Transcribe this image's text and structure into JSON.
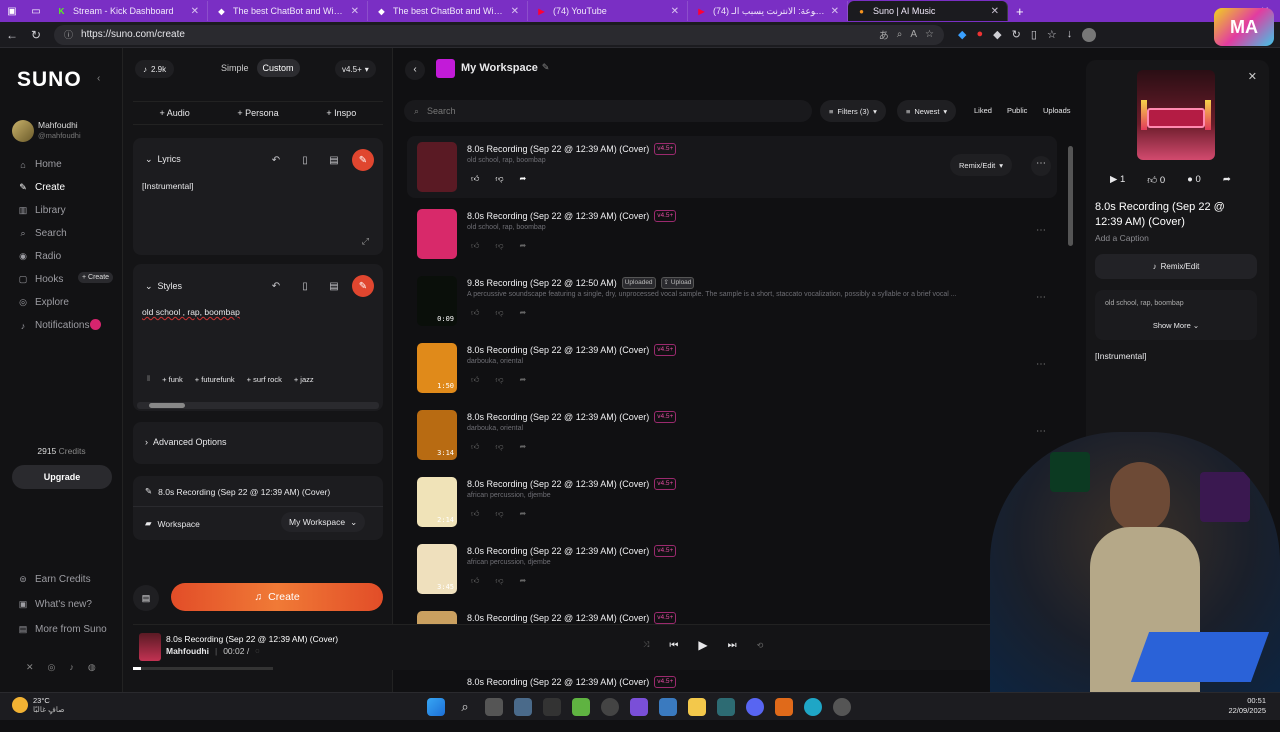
{
  "browser": {
    "tabs": [
      {
        "title": "Stream - Kick Dashboard",
        "fav": "K",
        "color": "#53fc18"
      },
      {
        "title": "The best ChatBot and Widgets fo",
        "fav": "◆",
        "color": "#ffffff"
      },
      {
        "title": "The best ChatBot and Widgets fo",
        "fav": "◆",
        "color": "#ffffff"
      },
      {
        "title": "(74) YouTube",
        "fav": "▶",
        "color": "#ff0033"
      },
      {
        "title": "(74) أسرار ممنوعة: الانترنت يسبب الـ",
        "fav": "▶",
        "color": "#ff0033"
      },
      {
        "title": "Suno | AI Music",
        "fav": "●",
        "color": "#f7931e"
      }
    ],
    "url": "https://suno.com/create"
  },
  "sidebar": {
    "logo": "SUNO",
    "user_name": "Mahfoudhi",
    "user_handle": "@mahfoudhi",
    "nav": [
      {
        "label": "Home",
        "icon": "home-icon",
        "glyph": "⌂"
      },
      {
        "label": "Create",
        "icon": "create-icon",
        "glyph": "✎"
      },
      {
        "label": "Library",
        "icon": "library-icon",
        "glyph": "▥"
      },
      {
        "label": "Search",
        "icon": "search-icon",
        "glyph": "⌕"
      },
      {
        "label": "Radio",
        "icon": "radio-icon",
        "glyph": "◉"
      },
      {
        "label": "Hooks",
        "icon": "hooks-icon",
        "glyph": "▢"
      },
      {
        "label": "Explore",
        "icon": "explore-icon",
        "glyph": "◎"
      },
      {
        "label": "Notifications",
        "icon": "bell-icon",
        "glyph": "♪"
      }
    ],
    "hooks_create": "+ Create",
    "credits": "2915",
    "credits_label": "Credits",
    "upgrade": "Upgrade",
    "bottom": [
      "Earn Credits",
      "What's new?",
      "More from Suno"
    ]
  },
  "create": {
    "count": "2.9k",
    "mode_simple": "Simple",
    "mode_custom": "Custom",
    "version": "v4.5+",
    "add_audio": "+ Audio",
    "add_persona": "+ Persona",
    "add_inspo": "+ Inspo",
    "lyrics_label": "Lyrics",
    "lyrics_value": "[Instrumental]",
    "styles_label": "Styles",
    "styles_value": "old school , rap, boombap",
    "style_chips": [
      "+ funk",
      "+ futurefunk",
      "+ surf rock",
      "+ jazz"
    ],
    "advanced": "Advanced Options",
    "song_title": "8.0s Recording (Sep 22 @ 12:39 AM) (Cover)",
    "workspace_label": "Workspace",
    "workspace_value": "My Workspace",
    "create_button": "Create"
  },
  "main": {
    "workspace_title": "My Workspace",
    "search_placeholder": "Search",
    "filters": "Filters (3)",
    "sort": "Newest",
    "liked": "Liked",
    "public": "Public",
    "uploads": "Uploads",
    "remix_edit": "Remix/Edit",
    "songs": [
      {
        "title": "8.0s Recording (Sep 22 @ 12:39 AM) (Cover)",
        "badge": "v4.5+",
        "tags": "old school, rap, boombap",
        "duration": "",
        "thumb": "#5a1a24"
      },
      {
        "title": "8.0s Recording (Sep 22 @ 12:39 AM) (Cover)",
        "badge": "v4.5+",
        "tags": "old school, rap, boombap",
        "duration": "",
        "thumb": "#d8296a"
      },
      {
        "title": "9.8s Recording (Sep 22 @ 12:50 AM)",
        "badge": "Uploaded",
        "badge2": "Upload",
        "tags": "A percussive soundscape featuring a single, dry, unprocessed vocal sample. The sample is a short, staccato vocalization, possibly a syllable or a brief vocal ...",
        "duration": "0:09",
        "thumb": "#0a0f0a"
      },
      {
        "title": "8.0s Recording (Sep 22 @ 12:39 AM) (Cover)",
        "badge": "v4.5+",
        "tags": "darbouka, oriental",
        "duration": "1:50",
        "thumb": "#e08a1a"
      },
      {
        "title": "8.0s Recording (Sep 22 @ 12:39 AM) (Cover)",
        "badge": "v4.5+",
        "tags": "darbouka, oriental",
        "duration": "3:14",
        "thumb": "#b86b12"
      },
      {
        "title": "8.0s Recording (Sep 22 @ 12:39 AM) (Cover)",
        "badge": "v4.5+",
        "tags": "african percussion, djembe",
        "duration": "2:14",
        "thumb": "#f0e3b8"
      },
      {
        "title": "8.0s Recording (Sep 22 @ 12:39 AM) (Cover)",
        "badge": "v4.5+",
        "tags": "african percussion, djembe",
        "duration": "3:45",
        "thumb": "#efe0bd"
      },
      {
        "title": "8.0s Recording (Sep 22 @ 12:39 AM) (Cover)",
        "badge": "v4.5+",
        "tags": "",
        "duration": "",
        "thumb": "#caa060"
      }
    ],
    "last_title": "8.0s Recording (Sep 22 @ 12:39 AM) (Cover)",
    "last_badge": "v4.5+"
  },
  "detail": {
    "plays": "1",
    "likes": "0",
    "comments": "0",
    "title": "8.0s Recording (Sep 22 @ 12:39 AM) (Cover)",
    "caption": "Add a Caption",
    "remix": "Remix/Edit",
    "tags": "old school, rap, boombap",
    "show_more": "Show More",
    "lyrics": "[Instrumental]"
  },
  "player": {
    "title": "8.0s Recording (Sep 22 @ 12:39 AM) (Cover)",
    "artist": "Mahfoudhi",
    "time": "00:02 /",
    "progress": 0.06
  },
  "taskbar": {
    "temp": "23°C",
    "weather": "صافٍ غالبًا",
    "time": "00:51",
    "date": "22/09/2025"
  }
}
